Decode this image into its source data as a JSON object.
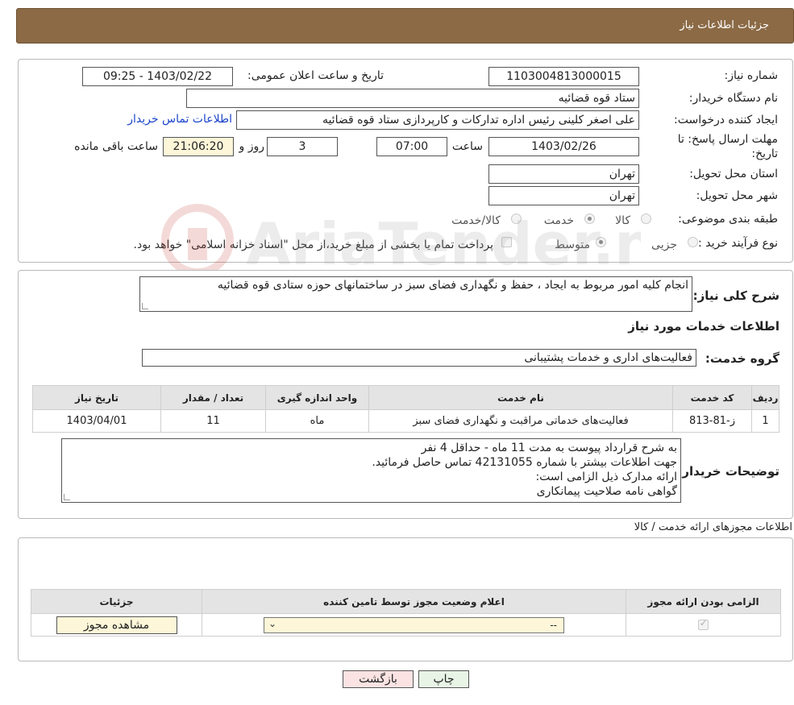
{
  "header": {
    "title": "جزئیات اطلاعات نیاز"
  },
  "info": {
    "need_number_label": "شماره نیاز:",
    "need_number": "1103004813000015",
    "announce_label": "تاریخ و ساعت اعلان عمومی:",
    "announce_value": "1403/02/22 - 09:25",
    "buyer_org_label": "نام دستگاه خریدار:",
    "buyer_org": "ستاد قوه قضائیه",
    "creator_label": "ایجاد کننده درخواست:",
    "creator": "علی اصغر کلینی رئیس اداره تدارکات و کارپردازی ستاد قوه قضائیه",
    "contact_link": "اطلاعات تماس خریدار",
    "deadline_label_1": "مهلت ارسال پاسخ: تا",
    "deadline_label_2": "تاریخ:",
    "deadline_date": "1403/02/26",
    "time_label": "ساعت",
    "deadline_time": "07:00",
    "days_value": "3",
    "days_label": "روز و",
    "remaining_time": "21:06:20",
    "remaining_label": "ساعت باقی مانده",
    "province_label": "استان محل تحویل:",
    "province": "تهران",
    "city_label": "شهر محل تحویل:",
    "city": "تهران",
    "category_label": "طبقه بندی موضوعی:",
    "category_options": [
      "کالا",
      "خدمت",
      "کالا/خدمت"
    ],
    "category_selected": "خدمت",
    "process_label": "نوع فرآیند خرید :",
    "process_options": [
      "جزیی",
      "متوسط"
    ],
    "process_selected": "متوسط",
    "payment_note": "پرداخت تمام یا بخشی از مبلغ خرید،از محل \"اسناد خزانه اسلامی\" خواهد بود."
  },
  "description": {
    "label": "شرح کلی نیاز:",
    "text": "انجام کلیه امور مربوط به ایجاد ، حفظ و نگهداری فضای سبز در ساختمانهای حوزه ستادی قوه قضائیه",
    "services_heading": "اطلاعات خدمات مورد نیاز",
    "service_group_label": "گروه خدمت:",
    "service_group": "فعالیت‌های اداری و خدمات پشتیبانی"
  },
  "services_table": {
    "headers": [
      "ردیف",
      "کد خدمت",
      "نام خدمت",
      "واحد اندازه گیری",
      "تعداد / مقدار",
      "تاریخ نیاز"
    ],
    "rows": [
      [
        "1",
        "ز-81-813",
        "فعالیت‌های خدماتی مراقبت و نگهداری فضای سبز",
        "ماه",
        "11",
        "1403/04/01"
      ]
    ]
  },
  "buyer_notes": {
    "label": "توضیحات خریدار:",
    "lines": [
      "به شرح قرارداد پیوست به مدت 11 ماه - حداقل 4 نفر",
      "جهت اطلاعات بیشتر با شماره 42131055 تماس حاصل فرمائید.",
      "ارائه مدارک ذیل الزامی است:",
      "گواهی نامه صلاحیت پیمانکاری"
    ]
  },
  "permits": {
    "heading": "اطلاعات مجوزهای ارائه خدمت / کالا",
    "headers": [
      "الزامی بودن ارائه مجوز",
      "اعلام وضعیت مجوز توسط تامین کننده",
      "جزئیات"
    ],
    "select_value": "--",
    "view_button": "مشاهده مجوز"
  },
  "actions": {
    "print": "چاپ",
    "back": "بازگشت"
  },
  "watermark": "AriaTender.neT"
}
